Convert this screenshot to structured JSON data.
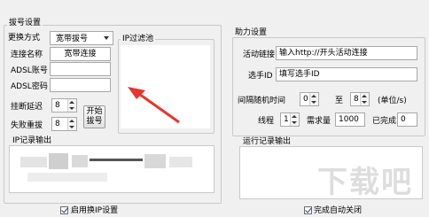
{
  "left_panel": {
    "group_title": "拔号设置",
    "change_mode_label": "更换方式",
    "change_mode_value": "宽带拔号",
    "connection_name_label": "连接名称",
    "connection_name_value": "宽带连接",
    "adsl_account_label": "ADSL账号",
    "adsl_account_value": "",
    "adsl_password_label": "ADSL密码",
    "adsl_password_value": "",
    "hangup_delay_label": "挂断延迟",
    "hangup_delay_value": "8",
    "fail_retry_label": "失败重拔",
    "fail_retry_value": "8",
    "start_dial_button": "开始拔号",
    "ip_filter_title": "IP过滤池",
    "ip_log_title": "IP记录输出",
    "enable_ip_setting_label": "启用换IP设置",
    "enable_ip_setting_checked": true
  },
  "right_panel": {
    "group_title": "助力设置",
    "activity_link_label": "活动链接",
    "activity_link_value": "输入http://开头活动连接",
    "player_id_label": "选手ID",
    "player_id_value": "填写选手ID",
    "interval_label": "间隔随机时间",
    "interval_min": "0",
    "interval_to": "至",
    "interval_max": "8",
    "interval_unit": "(单位/s)",
    "threads_label": "线程",
    "threads_value": "1",
    "required_label": "需求量",
    "required_value": "1000",
    "completed_label": "已完成",
    "completed_value": "0",
    "run_log_title": "运行记录输出",
    "auto_close_label": "完成自动关闭",
    "auto_close_checked": true
  },
  "icons": {
    "arrow": "red-pointer-arrow-annotation",
    "dropdown": "chevron-down-icon"
  },
  "colors": {
    "annotation_arrow": "#e8362d",
    "window_bg": "#f0f0f0",
    "checkbox_tick": "#1f3f8f"
  },
  "watermark": "下载吧"
}
